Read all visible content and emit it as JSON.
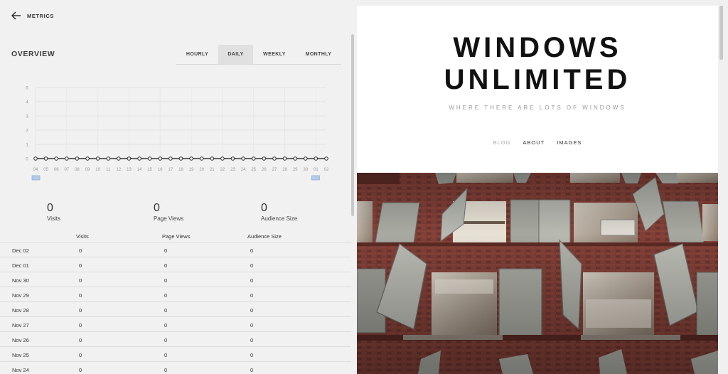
{
  "header": {
    "back_label": "METRICS"
  },
  "overview": {
    "title": "OVERVIEW",
    "tabs": [
      {
        "label": "HOURLY",
        "active": false
      },
      {
        "label": "DAILY",
        "active": true
      },
      {
        "label": "WEEKLY",
        "active": false
      },
      {
        "label": "MONTHLY",
        "active": false
      }
    ]
  },
  "chart_data": {
    "type": "line",
    "x": [
      "04",
      "05",
      "06",
      "07",
      "08",
      "09",
      "10",
      "11",
      "12",
      "13",
      "14",
      "15",
      "16",
      "17",
      "18",
      "19",
      "20",
      "21",
      "22",
      "23",
      "24",
      "25",
      "26",
      "27",
      "28",
      "29",
      "30",
      "01",
      "02"
    ],
    "values": [
      0,
      0,
      0,
      0,
      0,
      0,
      0,
      0,
      0,
      0,
      0,
      0,
      0,
      0,
      0,
      0,
      0,
      0,
      0,
      0,
      0,
      0,
      0,
      0,
      0,
      0,
      0,
      0,
      0
    ],
    "yticks": [
      "5",
      "4",
      "3",
      "2",
      "1",
      "0"
    ],
    "ylim": [
      0,
      5
    ],
    "grid": true
  },
  "stats": [
    {
      "value": "0",
      "label": "Visits"
    },
    {
      "value": "0",
      "label": "Page Views"
    },
    {
      "value": "0",
      "label": "Audience Size"
    }
  ],
  "table": {
    "headers": [
      "Visits",
      "Page Views",
      "Audience Size"
    ],
    "rows": [
      {
        "date": "Dec 02",
        "visits": "0",
        "page_views": "0",
        "audience": "0"
      },
      {
        "date": "Dec 01",
        "visits": "0",
        "page_views": "0",
        "audience": "0"
      },
      {
        "date": "Nov 30",
        "visits": "0",
        "page_views": "0",
        "audience": "0"
      },
      {
        "date": "Nov 29",
        "visits": "0",
        "page_views": "0",
        "audience": "0"
      },
      {
        "date": "Nov 28",
        "visits": "0",
        "page_views": "0",
        "audience": "0"
      },
      {
        "date": "Nov 27",
        "visits": "0",
        "page_views": "0",
        "audience": "0"
      },
      {
        "date": "Nov 26",
        "visits": "0",
        "page_views": "0",
        "audience": "0"
      },
      {
        "date": "Nov 25",
        "visits": "0",
        "page_views": "0",
        "audience": "0"
      },
      {
        "date": "Nov 24",
        "visits": "0",
        "page_views": "0",
        "audience": "0"
      }
    ]
  },
  "site": {
    "title_line1": "WINDOWS",
    "title_line2": "UNLIMITED",
    "tagline": "WHERE THERE ARE LOTS OF WINDOWS",
    "nav": [
      {
        "label": "BLOG",
        "active": true
      },
      {
        "label": "ABOUT",
        "active": false
      },
      {
        "label": "IMAGES",
        "active": false
      }
    ]
  },
  "colors": {
    "brick": "#7a3b33",
    "shutter": "#a9aaa2",
    "chart_line": "#333333",
    "range_handle": "#b5cbe6"
  }
}
